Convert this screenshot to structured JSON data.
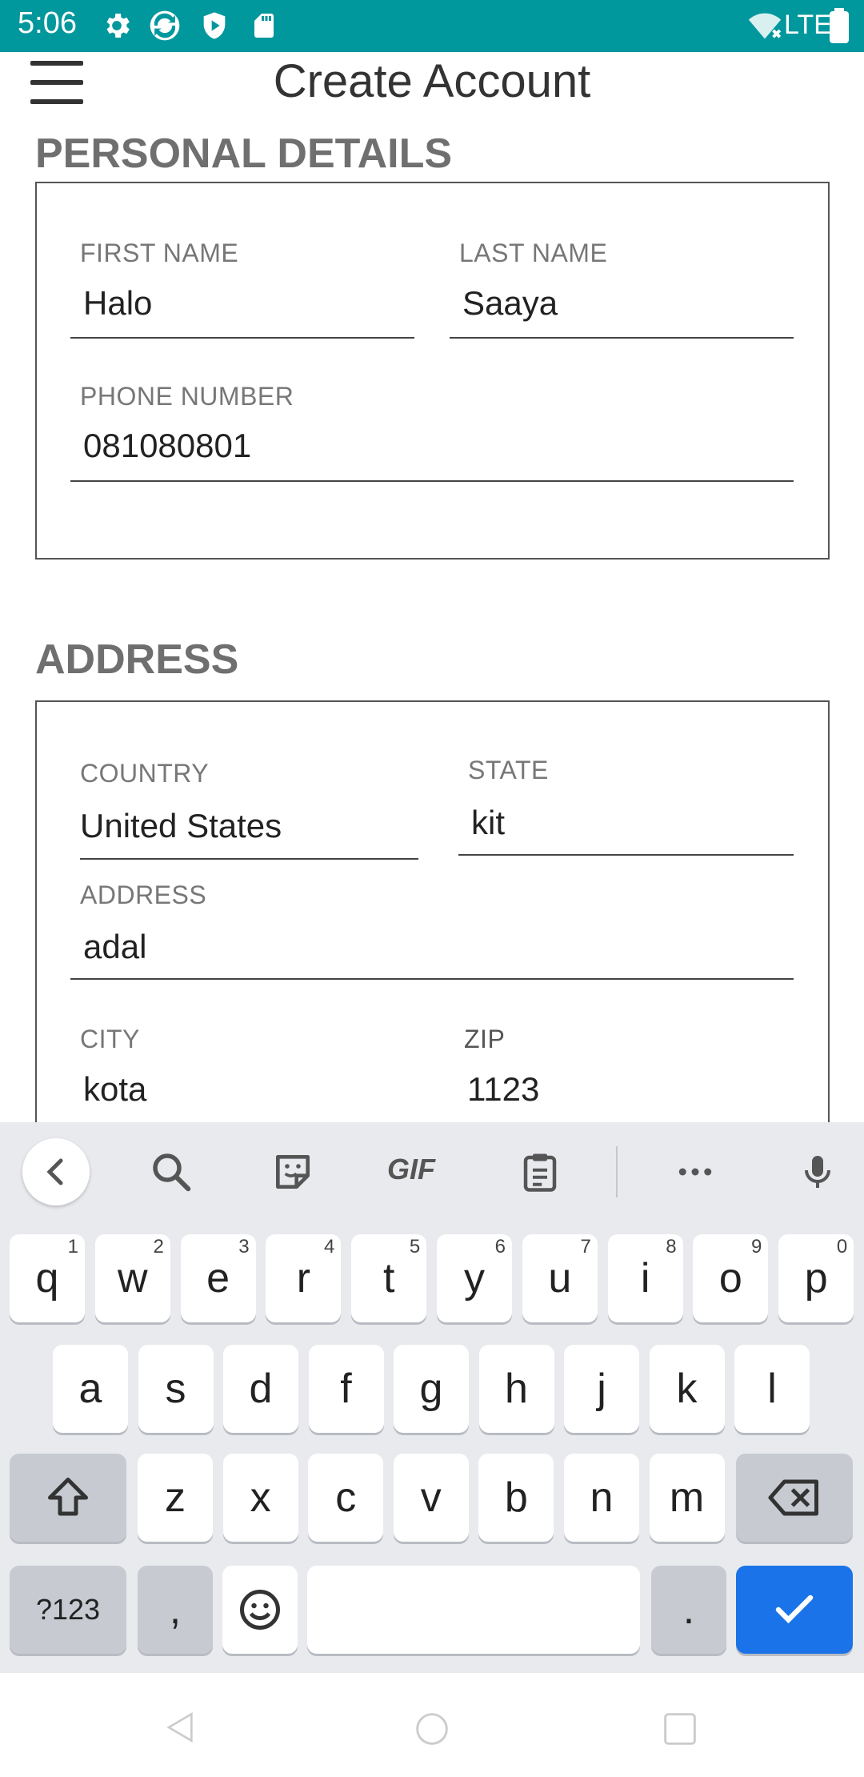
{
  "status_bar": {
    "time": "5:06",
    "network": "LTE"
  },
  "app_bar": {
    "title": "Create Account"
  },
  "personal_details": {
    "title": "PERSONAL DETAILS",
    "first_name": {
      "label": "FIRST NAME",
      "value": "Halo"
    },
    "last_name": {
      "label": "LAST NAME",
      "value": "Saaya"
    },
    "phone": {
      "label": "PHONE NUMBER",
      "value": "081080801"
    }
  },
  "address": {
    "title": "ADDRESS",
    "country": {
      "label": "COUNTRY",
      "value": "United States"
    },
    "state": {
      "label": "STATE",
      "value": "kit"
    },
    "address": {
      "label": "ADDRESS",
      "value": "adal"
    },
    "city": {
      "label": "CITY",
      "value": "kota"
    },
    "zip": {
      "label": "ZIP",
      "value": "1123"
    }
  },
  "keyboard": {
    "toolbar": {
      "gif_label": "GIF"
    },
    "row1": [
      {
        "key": "q",
        "hint": "1"
      },
      {
        "key": "w",
        "hint": "2"
      },
      {
        "key": "e",
        "hint": "3"
      },
      {
        "key": "r",
        "hint": "4"
      },
      {
        "key": "t",
        "hint": "5"
      },
      {
        "key": "y",
        "hint": "6"
      },
      {
        "key": "u",
        "hint": "7"
      },
      {
        "key": "i",
        "hint": "8"
      },
      {
        "key": "o",
        "hint": "9"
      },
      {
        "key": "p",
        "hint": "0"
      }
    ],
    "row2": [
      "a",
      "s",
      "d",
      "f",
      "g",
      "h",
      "j",
      "k",
      "l"
    ],
    "row3": [
      "z",
      "x",
      "c",
      "v",
      "b",
      "n",
      "m"
    ],
    "symbols_label": "?123",
    "comma": ",",
    "period": "."
  }
}
